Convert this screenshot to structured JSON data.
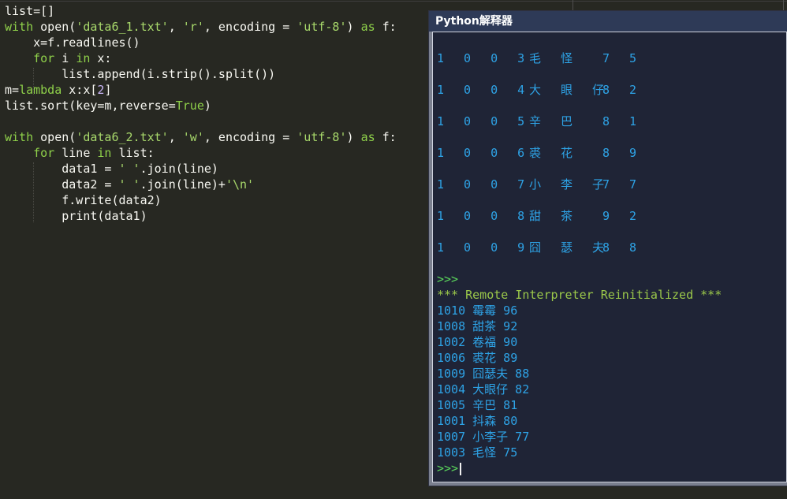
{
  "editor": {
    "lines": [
      {
        "parts": [
          {
            "t": "list=[]",
            "c": "id"
          }
        ]
      },
      {
        "parts": [
          {
            "t": "with ",
            "c": "kw"
          },
          {
            "t": "open(",
            "c": "id"
          },
          {
            "t": "'data6_1.txt'",
            "c": "str"
          },
          {
            "t": ", ",
            "c": "id"
          },
          {
            "t": "'r'",
            "c": "str"
          },
          {
            "t": ", encoding = ",
            "c": "id"
          },
          {
            "t": "'utf-8'",
            "c": "str"
          },
          {
            "t": ") ",
            "c": "id"
          },
          {
            "t": "as ",
            "c": "kw"
          },
          {
            "t": "f:",
            "c": "id"
          }
        ]
      },
      {
        "parts": [
          {
            "t": "    x=f.readlines()",
            "c": "id"
          }
        ]
      },
      {
        "parts": [
          {
            "t": "    ",
            "c": "id"
          },
          {
            "t": "for ",
            "c": "kw"
          },
          {
            "t": "i ",
            "c": "id"
          },
          {
            "t": "in ",
            "c": "kw"
          },
          {
            "t": "x:",
            "c": "id"
          }
        ]
      },
      {
        "parts": [
          {
            "t": "        list.append(i.strip().split())",
            "c": "id"
          }
        ]
      },
      {
        "parts": [
          {
            "t": "m=",
            "c": "id"
          },
          {
            "t": "lambda ",
            "c": "kw"
          },
          {
            "t": "x:x[",
            "c": "id"
          },
          {
            "t": "2",
            "c": "num"
          },
          {
            "t": "]",
            "c": "id"
          }
        ]
      },
      {
        "parts": [
          {
            "t": "list.sort(key=m,reverse=",
            "c": "id"
          },
          {
            "t": "True",
            "c": "kw"
          },
          {
            "t": ")",
            "c": "id"
          }
        ]
      },
      {
        "parts": [
          {
            "t": "",
            "c": "id"
          }
        ]
      },
      {
        "parts": [
          {
            "t": "with ",
            "c": "kw"
          },
          {
            "t": "open(",
            "c": "id"
          },
          {
            "t": "'data6_2.txt'",
            "c": "str"
          },
          {
            "t": ", ",
            "c": "id"
          },
          {
            "t": "'w'",
            "c": "str"
          },
          {
            "t": ", encoding = ",
            "c": "id"
          },
          {
            "t": "'utf-8'",
            "c": "str"
          },
          {
            "t": ") ",
            "c": "id"
          },
          {
            "t": "as ",
            "c": "kw"
          },
          {
            "t": "f:",
            "c": "id"
          }
        ]
      },
      {
        "parts": [
          {
            "t": "    ",
            "c": "id"
          },
          {
            "t": "for ",
            "c": "kw"
          },
          {
            "t": "line ",
            "c": "id"
          },
          {
            "t": "in ",
            "c": "kw"
          },
          {
            "t": "list:",
            "c": "id"
          }
        ]
      },
      {
        "parts": [
          {
            "t": "        data1 = ",
            "c": "id"
          },
          {
            "t": "' '",
            "c": "str"
          },
          {
            "t": ".join(line)",
            "c": "id"
          }
        ]
      },
      {
        "parts": [
          {
            "t": "        data2 = ",
            "c": "id"
          },
          {
            "t": "' '",
            "c": "str"
          },
          {
            "t": ".join(line)+",
            "c": "id"
          },
          {
            "t": "'\\n'",
            "c": "str"
          }
        ]
      },
      {
        "parts": [
          {
            "t": "        f.write(data2)",
            "c": "id"
          }
        ]
      },
      {
        "parts": [
          {
            "t": "        print(data1)",
            "c": "id"
          }
        ]
      }
    ]
  },
  "interpreter": {
    "title": "Python解释器",
    "spaced_rows": [
      {
        "id": "1 0 0 3",
        "name": "毛 怪",
        "score": "7 5"
      },
      {
        "id": "1 0 0 4",
        "name": "大 眼 仔",
        "score": "8 2"
      },
      {
        "id": "1 0 0 5",
        "name": "辛 巴",
        "score": "8 1"
      },
      {
        "id": "1 0 0 6",
        "name": "裘 花",
        "score": "8 9"
      },
      {
        "id": "1 0 0 7",
        "name": "小 李 子",
        "score": "7 7"
      },
      {
        "id": "1 0 0 8",
        "name": "甜 茶",
        "score": "9 2"
      },
      {
        "id": "1 0 0 9",
        "name": "囧 瑟 夫",
        "score": "8 8"
      }
    ],
    "prompt1": ">>>",
    "reinit_message": "*** Remote Interpreter Reinitialized ***",
    "output_lines": [
      "1010 霉霉 96",
      "1008 甜茶 92",
      "1002 卷福 90",
      "1006 裘花 89",
      "1009 囧瑟夫 88",
      "1004 大眼仔 82",
      "1005 辛巴 81",
      "1001 抖森 80",
      "1007 小李子 77",
      "1003 毛怪 75"
    ],
    "prompt2": ">>>"
  }
}
